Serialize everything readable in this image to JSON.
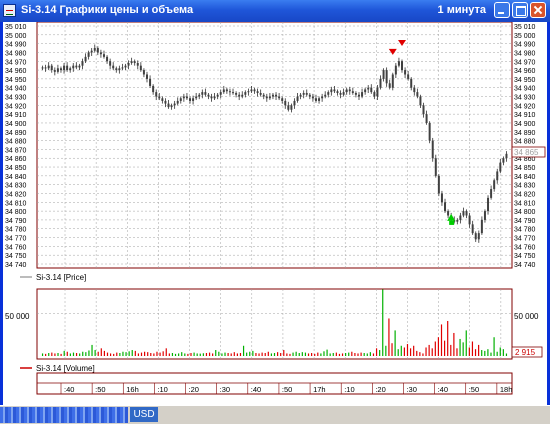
{
  "window": {
    "title": "Si-3.14 Графики цены и объема",
    "timeframe": "1 минута",
    "minimize": "minimize",
    "maximize": "maximize",
    "close": "close"
  },
  "price_panel": {
    "legend": "Si-3.14 [Price]",
    "current_price_label": "34 865",
    "y_ticks": [
      "35 010",
      "35 000",
      "34 990",
      "34 980",
      "34 970",
      "34 960",
      "34 950",
      "34 940",
      "34 930",
      "34 920",
      "34 910",
      "34 900",
      "34 890",
      "34 880",
      "34 870",
      "34 860",
      "34 850",
      "34 840",
      "34 830",
      "34 820",
      "34 810",
      "34 800",
      "34 790",
      "34 780",
      "34 770",
      "34 760",
      "34 750",
      "34 740"
    ]
  },
  "volume_panel": {
    "legend": "Si-3.14 [Volume]",
    "y_tick": "50 000",
    "current_volume_label": "2 915"
  },
  "time_axis": {
    "labels": [
      ":40",
      ":50",
      "16h",
      ":10",
      ":20",
      ":30",
      ":40",
      ":50",
      "17h",
      ":10",
      ":20",
      ":30",
      ":40",
      ":50",
      "18h"
    ]
  },
  "taskbar": {
    "button_label": "USD"
  },
  "colors": {
    "up": "#00b000",
    "down": "#e00000",
    "volume_legend": "#cc0000",
    "frame": "#800000",
    "grid": "#a0a0a0",
    "titlebar": "#1f56d9",
    "buy_marker": "#00cc00",
    "sell_marker": "#e00000"
  },
  "chart_data": [
    {
      "type": "candlestick",
      "series_name": "Si-3.14 [Price]",
      "ylim": [
        34740,
        35010
      ],
      "x_ticks": [
        ":40",
        ":50",
        "16h",
        ":10",
        ":20",
        ":30",
        ":40",
        ":50",
        "17h",
        ":10",
        ":20",
        ":30",
        ":40",
        ":50",
        "18h"
      ],
      "close": [
        34963,
        34962,
        34965,
        34960,
        34958,
        34962,
        34960,
        34965,
        34960,
        34962,
        34965,
        34963,
        34965,
        34970,
        34975,
        34980,
        34982,
        34985,
        34980,
        34978,
        34975,
        34970,
        34965,
        34962,
        34960,
        34962,
        34963,
        34965,
        34968,
        34970,
        34968,
        34965,
        34960,
        34955,
        34950,
        34942,
        34935,
        34930,
        34928,
        34925,
        34922,
        34918,
        34920,
        34922,
        34925,
        34928,
        34930,
        34928,
        34925,
        34928,
        34930,
        34932,
        34935,
        34932,
        34930,
        34928,
        34930,
        34932,
        34935,
        34938,
        34936,
        34935,
        34934,
        34932,
        34930,
        34932,
        34935,
        34936,
        34938,
        34936,
        34934,
        34932,
        34930,
        34928,
        34930,
        34932,
        34930,
        34928,
        34925,
        34920,
        34915,
        34920,
        34925,
        34930,
        34932,
        34934,
        34932,
        34930,
        34928,
        34925,
        34928,
        34930,
        34932,
        34935,
        34938,
        34936,
        34934,
        34932,
        34935,
        34938,
        34936,
        34934,
        34932,
        34930,
        34935,
        34938,
        34940,
        34935,
        34930,
        34940,
        34950,
        34960,
        34945,
        34940,
        34955,
        34965,
        34970,
        34960,
        34955,
        34950,
        34940,
        34935,
        34930,
        34920,
        34910,
        34900,
        34880,
        34860,
        34840,
        34820,
        34810,
        34800,
        34795,
        34790,
        34788,
        34790,
        34795,
        34800,
        34795,
        34785,
        34775,
        34768,
        34775,
        34790,
        34800,
        34815,
        34825,
        34835,
        34845,
        34855,
        34860,
        34865
      ],
      "markers": [
        {
          "type": "sell",
          "value": 34975
        },
        {
          "type": "sell",
          "value": 34985
        },
        {
          "type": "buy",
          "value": 34790
        }
      ]
    },
    {
      "type": "bar",
      "series_name": "Si-3.14 [Volume]",
      "ylim": [
        0,
        75000
      ],
      "y_ticks": [
        50000
      ],
      "values": [
        3000,
        2500,
        3500,
        4000,
        3000,
        3500,
        2500,
        6000,
        5000,
        3000,
        4000,
        3500,
        3000,
        5000,
        4500,
        6500,
        13000,
        7000,
        5000,
        9000,
        6000,
        4000,
        3000,
        2500,
        4000,
        3500,
        5000,
        4500,
        5500,
        7000,
        6000,
        3000,
        4000,
        5000,
        4500,
        3500,
        3000,
        5000,
        4000,
        5500,
        9000,
        3000,
        3500,
        2500,
        3000,
        4500,
        3000,
        2500,
        3500,
        4000,
        3000,
        2800,
        3200,
        3500,
        4000,
        3000,
        7000,
        5000,
        3000,
        4000,
        3500,
        3000,
        4500,
        3000,
        3500,
        12000,
        4000,
        5000,
        6000,
        3500,
        3000,
        4000,
        3500,
        5000,
        3000,
        3500,
        4500,
        3500,
        7000,
        3000,
        2500,
        4000,
        5000,
        3500,
        4500,
        4000,
        3000,
        3500,
        2500,
        4000,
        3000,
        5500,
        7500,
        3000,
        3500,
        4000,
        2500,
        3000,
        3500,
        4000,
        5000,
        3500,
        3000,
        4000,
        3500,
        3000,
        4500,
        3000,
        9000,
        7000,
        78000,
        12000,
        44000,
        15000,
        30000,
        8000,
        12000,
        10000,
        14000,
        9000,
        12000,
        6000,
        4500,
        3000,
        10000,
        13000,
        9000,
        17000,
        22000,
        37000,
        18000,
        41000,
        13000,
        27000,
        9000,
        20000,
        16000,
        30000,
        10000,
        17000,
        8000,
        13000,
        7000,
        6000,
        8000,
        4000,
        22000,
        5000,
        10000,
        8000,
        2915
      ],
      "markers": []
    }
  ]
}
